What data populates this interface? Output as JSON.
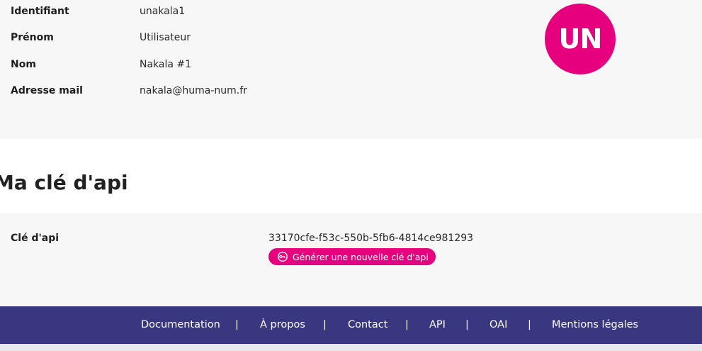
{
  "profile": {
    "fields": [
      {
        "label": "Identifiant",
        "value": "unakala1"
      },
      {
        "label": "Prénom",
        "value": "Utilisateur"
      },
      {
        "label": "Nom",
        "value": "Nakala #1"
      },
      {
        "label": "Adresse mail",
        "value": "nakala@huma-num.fr"
      }
    ],
    "avatar_initials": "UN",
    "avatar_color": "#e6007e"
  },
  "api_section": {
    "title": "Ma clé d'api",
    "label": "Clé d'api",
    "key": "33170cfe-f53c-550b-5fb6-4814ce981293",
    "generate_button": "Générer une nouvelle clé d'api",
    "generate_icon": "key-icon"
  },
  "footer": {
    "links": [
      "Documentation",
      "À propos",
      "Contact",
      "API",
      "OAI",
      "Mentions légales"
    ],
    "separator": "|",
    "background": "#39377f"
  }
}
